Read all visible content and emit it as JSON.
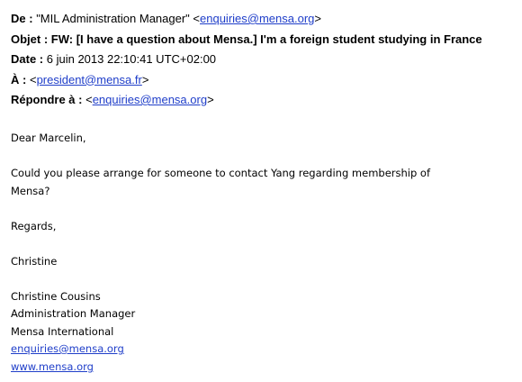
{
  "headers": {
    "from": {
      "label": "De :",
      "name": "\"MIL Administration Manager\"",
      "lt": "<",
      "email": "enquiries@mensa.org",
      "gt": ">"
    },
    "subject": {
      "label": "Objet :",
      "value": "FW: [I have a question about Mensa.] I'm a foreign student studying in France"
    },
    "date": {
      "label": "Date :",
      "value": "6 juin 2013 22:10:41 UTC+02:00"
    },
    "to": {
      "label": "À :",
      "lt": "<",
      "email": "president@mensa.fr",
      "gt": ">"
    },
    "reply_to": {
      "label": "Répondre à :",
      "lt": "<",
      "email": "enquiries@mensa.org",
      "gt": ">"
    }
  },
  "body": {
    "greeting": "Dear Marcelin,",
    "paragraph_line1": "Could you please arrange for someone to contact Yang regarding membership of",
    "paragraph_line2": "Mensa?",
    "closing": "Regards,",
    "sender_first": "Christine",
    "signature": {
      "name": "Christine Cousins",
      "title": "Administration Manager",
      "org": "Mensa International",
      "email": "enquiries@mensa.org",
      "website": "www.mensa.org"
    }
  },
  "colors": {
    "link": "#1f3ec9",
    "text": "#000000",
    "background": "#ffffff"
  }
}
